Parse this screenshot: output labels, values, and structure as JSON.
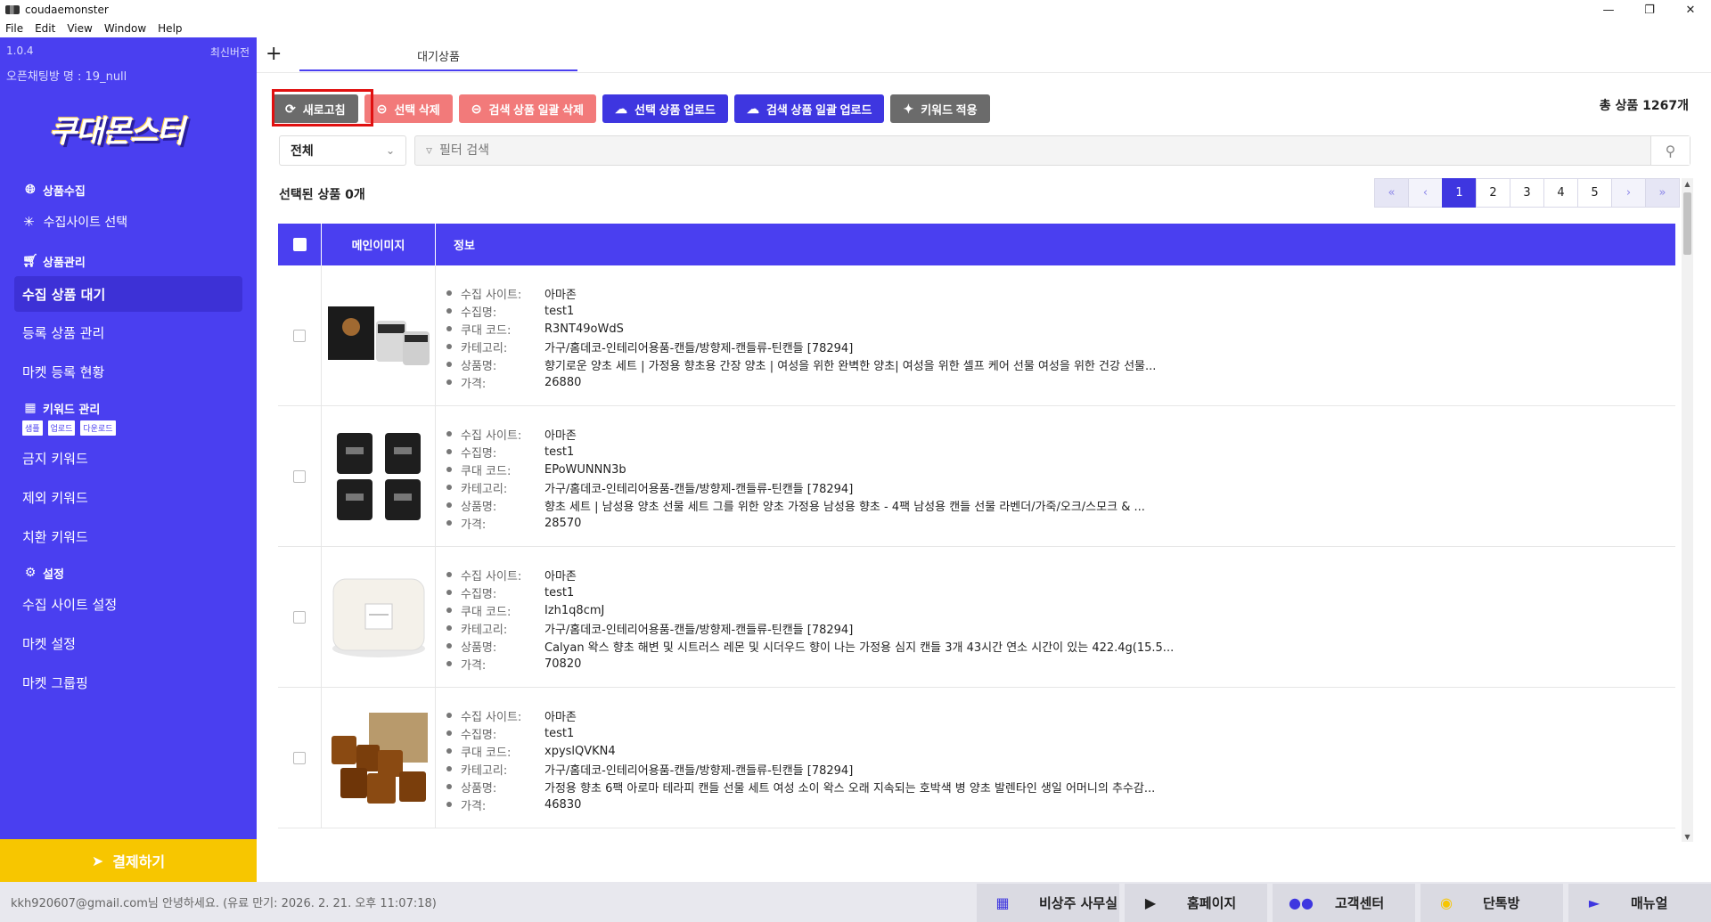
{
  "window": {
    "title": "coudaemonster",
    "menu": [
      "File",
      "Edit",
      "View",
      "Window",
      "Help"
    ]
  },
  "sidebar": {
    "version": "1.0.4",
    "latest": "최신버전",
    "room": "오픈채팅방 명 : 19_null",
    "logo": "쿠대몬스터",
    "collect_head": "상품수집",
    "collect_site": "수집사이트 선택",
    "manage_head": "상품관리",
    "manage_items": [
      "수집 상품 대기",
      "등록 상품 관리",
      "마켓 등록 현황"
    ],
    "keyword_head": "키워드 관리",
    "keyword_tags": [
      "샘플",
      "업로드",
      "다운로드"
    ],
    "keyword_items": [
      "금지 키워드",
      "제외 키워드",
      "치환 키워드"
    ],
    "settings_head": "설정",
    "settings_items": [
      "수집 사이트 설정",
      "마켓 설정",
      "마켓 그룹핑"
    ],
    "pay": "결제하기"
  },
  "tabs": {
    "plus": "+",
    "active": "대기상품"
  },
  "toolbar": {
    "refresh": "새로고침",
    "delete_selected": "선택 삭제",
    "delete_search_all": "검색 상품 일괄 삭제",
    "upload_selected": "선택 상품 업로드",
    "upload_search_all": "검색 상품 일괄 업로드",
    "apply_keyword": "키워드 적용",
    "total": "총 상품 1267개"
  },
  "filter": {
    "select_value": "전체",
    "search_placeholder": "필터 검색"
  },
  "selected_count": "선택된 상품  0개",
  "pager": {
    "pages": [
      "1",
      "2",
      "3",
      "4",
      "5"
    ],
    "active": "1"
  },
  "table": {
    "headers": [
      "메인이미지",
      "정보"
    ],
    "labels": [
      "수집 사이트:",
      "수집명:",
      "쿠대 코드:",
      "카테고리:",
      "상품명:",
      "가격:"
    ],
    "rows": [
      {
        "site": "아마존",
        "name": "test1",
        "code": "R3NT49oWdS",
        "category": "가구/홈데코-인테리어용품-캔들/방향제-캔들류-틴캔들 [78294]",
        "product": "향기로운 양초 세트 | 가정용 향초용 간장 양초 | 여성을 위한 완벽한 양초| 여성을 위한 셀프 케어 선물 여성을 위한 건강 선물...",
        "price": "26880"
      },
      {
        "site": "아마존",
        "name": "test1",
        "code": "EPoWUNNN3b",
        "category": "가구/홈데코-인테리어용품-캔들/방향제-캔들류-틴캔들 [78294]",
        "product": "향초 세트 | 남성용 양초 선물 세트 그를 위한 양초 가정용 남성용 향초 - 4팩 남성용 캔들 선물 라벤더/가죽/오크/스모크 & ...",
        "price": "28570"
      },
      {
        "site": "아마존",
        "name": "test1",
        "code": "Izh1q8cmJ",
        "category": "가구/홈데코-인테리어용품-캔들/방향제-캔들류-틴캔들 [78294]",
        "product": "Calyan 왁스 향초 해변 및 시트러스 레몬 및 시더우드 향이 나는 가정용 심지 캔들 3개 43시간 연소 시간이 있는 422.4g(15.5...",
        "price": "70820"
      },
      {
        "site": "아마존",
        "name": "test1",
        "code": "xpyslQVKN4",
        "category": "가구/홈데코-인테리어용품-캔들/방향제-캔들류-틴캔들 [78294]",
        "product": "가정용 향초 6팩 아로마 테라피 캔들 선물 세트 여성 소이 왁스 오래 지속되는 호박색 병 양초 발렌타인 생일 어머니의 추수감...",
        "price": "46830"
      }
    ]
  },
  "bottom": {
    "status": "kkh920607@gmail.com님 안녕하세요. (유료 만기: 2026. 2. 21. 오후 11:07:18)",
    "buttons": [
      "비상주 사무실",
      "홈페이지",
      "고객센터",
      "단톡방",
      "매뉴얼"
    ]
  },
  "colors": {
    "brand": "#4a3ff0",
    "pay": "#f7c600",
    "danger": "#f27a7a",
    "primary": "#3e36e0",
    "highlight": "#e01010"
  }
}
